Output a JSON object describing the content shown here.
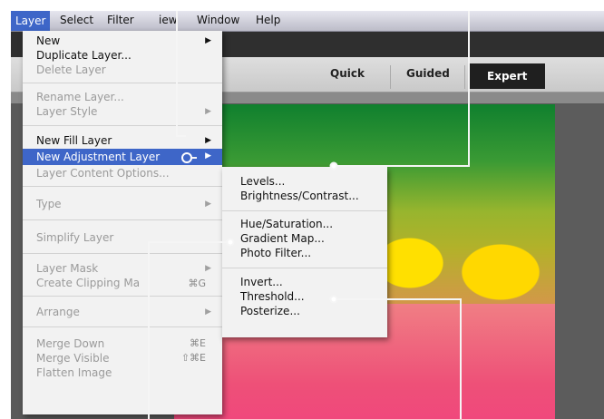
{
  "menubar": {
    "items": [
      "Layer",
      "Select",
      "Filter",
      "View",
      "Window",
      "Help"
    ],
    "view_shown": "iew"
  },
  "toolbar": {
    "modes": [
      "Quick",
      "Guided",
      "Expert"
    ]
  },
  "layer_menu": {
    "new": "New",
    "duplicate_layer": "Duplicate Layer...",
    "delete_layer": "Delete Layer",
    "rename_layer": "Rename Layer...",
    "layer_style": "Layer Style",
    "new_fill_layer": "New Fill Layer",
    "new_adjustment_layer": "New Adjustment Layer",
    "layer_content_options": "Layer Content Options...",
    "type": "Type",
    "simplify_layer": "Simplify Layer",
    "layer_mask": "Layer Mask",
    "create_clipping_mask": "Create Clipping Ma",
    "create_clipping_mask_shortcut": "⌘G",
    "arrange": "Arrange",
    "merge_down": "Merge Down",
    "merge_down_shortcut": "⌘E",
    "merge_visible": "Merge Visible",
    "merge_visible_shortcut": "⇧⌘E",
    "flatten_image": "Flatten Image"
  },
  "adjustment_menu": {
    "levels": "Levels...",
    "brightness_contrast": "Brightness/Contrast...",
    "hue_saturation": "Hue/Saturation...",
    "gradient_map": "Gradient Map...",
    "photo_filter": "Photo Filter...",
    "invert": "Invert...",
    "threshold": "Threshold...",
    "posterize": "Posterize..."
  },
  "colors": {
    "highlight": "#3e66c8",
    "menu_bg": "#f2f2f2",
    "disabled_text": "#9a9a9a"
  }
}
